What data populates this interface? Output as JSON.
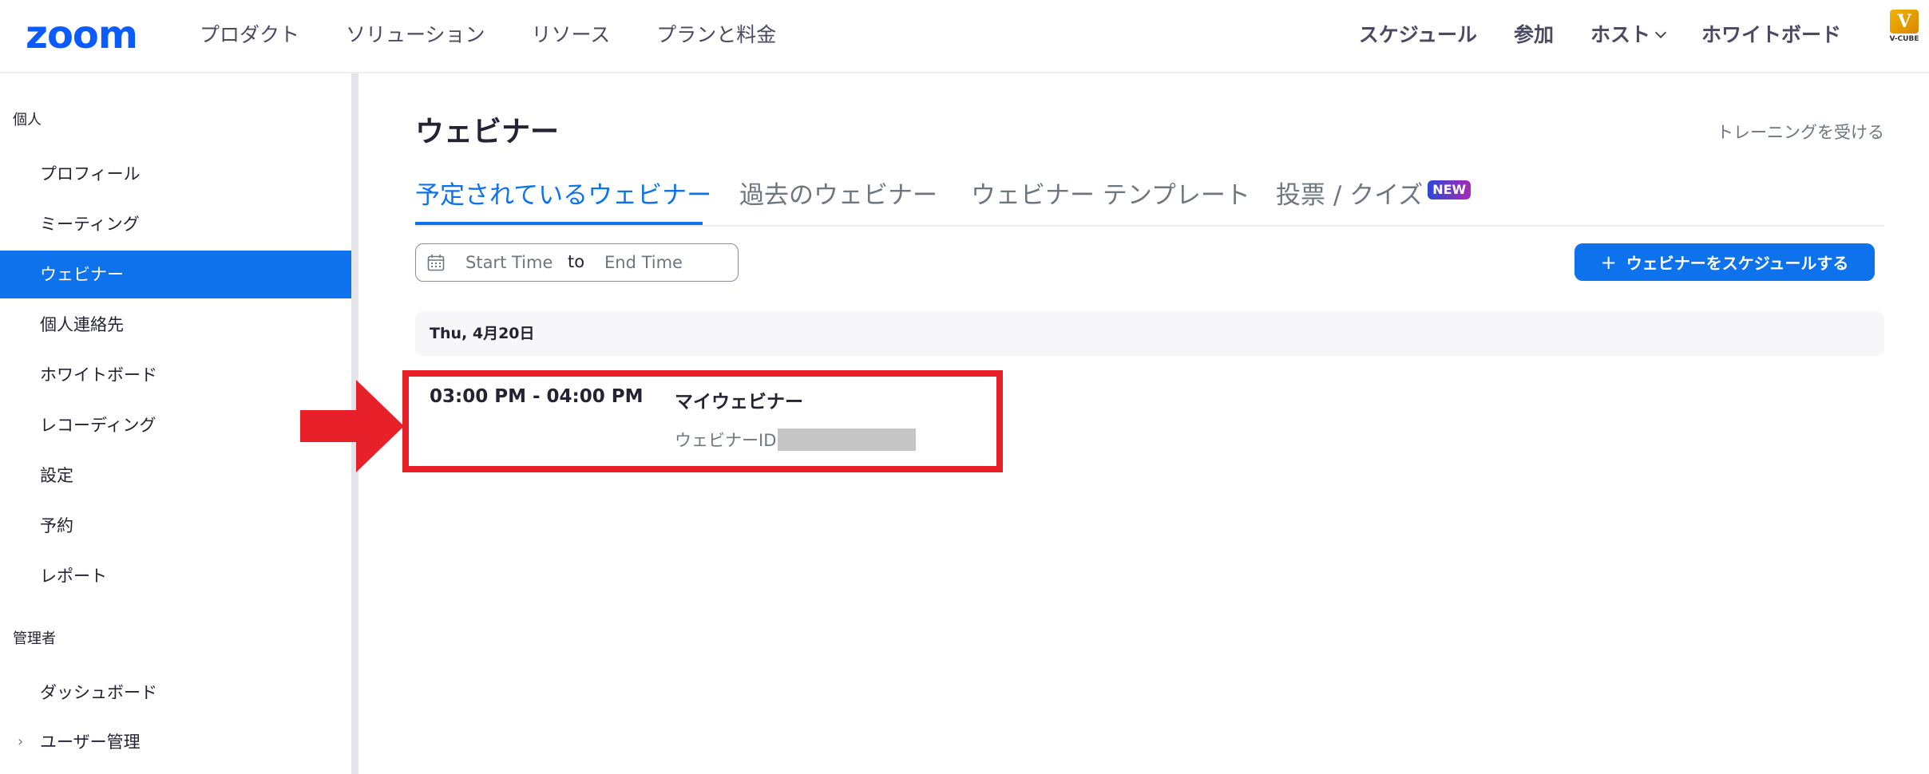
{
  "header": {
    "logo": "zoom",
    "nav_left": [
      "プロダクト",
      "ソリューション",
      "リソース",
      "プランと料金"
    ],
    "nav_right": {
      "schedule": "スケジュール",
      "join": "参加",
      "host": "ホスト",
      "whiteboard": "ホワイトボード"
    },
    "partner_logo": "V-CUBE"
  },
  "sidebar": {
    "personal_title": "個人",
    "personal_items": [
      "プロフィール",
      "ミーティング",
      "ウェビナー",
      "個人連絡先",
      "ホワイトボード",
      "レコーディング",
      "設定",
      "予約",
      "レポート"
    ],
    "active_item": "ウェビナー",
    "admin_title": "管理者",
    "admin_items": [
      "ダッシュボード",
      "ユーザー管理"
    ]
  },
  "main": {
    "title": "ウェビナー",
    "training_link": "トレーニングを受ける",
    "tabs": [
      {
        "label": "予定されているウェビナー",
        "active": true
      },
      {
        "label": "過去のウェビナー",
        "active": false
      },
      {
        "label": "ウェビナー テンプレート",
        "active": false
      },
      {
        "label": "投票 / クイズ",
        "active": false,
        "badge": "NEW"
      }
    ],
    "date_filter": {
      "start_placeholder": "Start Time",
      "separator": "to",
      "end_placeholder": "End Time"
    },
    "schedule_button": "ウェビナーをスケジュールする",
    "date_group": "Thu, 4月20日",
    "webinars": [
      {
        "time": "03:00 PM - 04:00 PM",
        "title": "マイウェビナー",
        "id_label": "ウェビナーID"
      }
    ]
  },
  "colors": {
    "brand": "#0b5cff",
    "accent": "#0e72ed",
    "highlight": "#e8202a"
  }
}
